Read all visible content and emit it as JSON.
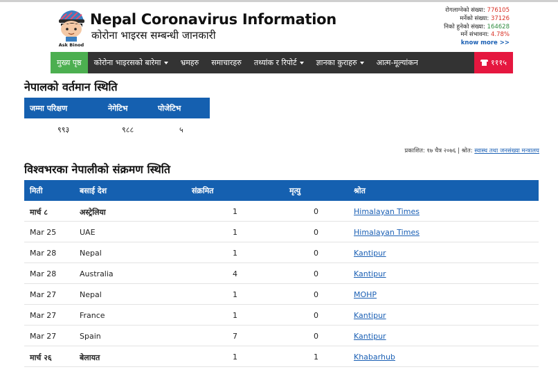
{
  "header": {
    "title": "Nepal Coronavirus Information",
    "subtitle": "कोरोना भाइरस सम्बन्धी जानकारी",
    "logo_text": "Ask Binod",
    "stats": [
      {
        "label": "रोगलाग्नेको संख्या:",
        "value": "776105",
        "color": "#d93025"
      },
      {
        "label": "मर्नेको संख्या:",
        "value": "37126",
        "color": "#d93025"
      },
      {
        "label": "निको हुनेको संख्या:",
        "value": "164628",
        "color": "#2e8b3e"
      },
      {
        "label": "मर्ने संभावना:",
        "value": "4.78%",
        "color": "#d93025"
      }
    ],
    "know_more": "know more >>"
  },
  "nav": {
    "items": [
      {
        "label": "मुख्य पृष्ठ",
        "active": true,
        "dropdown": false
      },
      {
        "label": "कोरोना भाइरसको बारेमा",
        "active": false,
        "dropdown": true
      },
      {
        "label": "भ्रमहरु",
        "active": false,
        "dropdown": false
      },
      {
        "label": "समाचारहरु",
        "active": false,
        "dropdown": false
      },
      {
        "label": "तथ्यांक र रिपोर्ट",
        "active": false,
        "dropdown": true
      },
      {
        "label": "ज्ञानका कुराहरु",
        "active": false,
        "dropdown": true
      },
      {
        "label": "आत्म-मूल्यांकन",
        "active": false,
        "dropdown": false
      }
    ],
    "hotline": "१११५",
    "hotline_icon": "phone-icon"
  },
  "nepal_status": {
    "heading": "नेपालको वर्तमान स्थिति",
    "columns": [
      "जम्मा परिक्षण",
      "नेगेटिभ",
      "पोजेटिभ"
    ],
    "values": [
      "९९३",
      "९८८",
      "५"
    ],
    "source_prefix": "प्रकाशित: १७ चैत्र २०७६ | श्रोत:",
    "source_link": "स्वास्थ तथा जनसंख्या मन्त्रालय"
  },
  "world_status": {
    "heading": "विश्वभरका नेपालीको संक्रमण स्थिति",
    "columns": [
      "मिती",
      "बसाई देश",
      "संक्रमित",
      "मृत्यु",
      "श्रोत"
    ],
    "rows": [
      {
        "date": "मार्च ८",
        "country": "अस्ट्रेलिया",
        "infected": "1",
        "deaths": "0",
        "source": "Himalayan Times",
        "native": true
      },
      {
        "date": "Mar 25",
        "country": "UAE",
        "infected": "1",
        "deaths": "0",
        "source": "Himalayan Times",
        "native": false
      },
      {
        "date": "Mar 28",
        "country": "Nepal",
        "infected": "1",
        "deaths": "0",
        "source": "Kantipur",
        "native": false
      },
      {
        "date": "Mar 28",
        "country": "Australia",
        "infected": "4",
        "deaths": "0",
        "source": "Kantipur",
        "native": false
      },
      {
        "date": "Mar 27",
        "country": "Nepal",
        "infected": "1",
        "deaths": "0",
        "source": "MOHP",
        "native": false
      },
      {
        "date": "Mar 27",
        "country": "France",
        "infected": "1",
        "deaths": "0",
        "source": "Kantipur",
        "native": false
      },
      {
        "date": "Mar 27",
        "country": "Spain",
        "infected": "7",
        "deaths": "0",
        "source": "Kantipur",
        "native": false
      },
      {
        "date": "मार्च २६",
        "country": "बेलायत",
        "infected": "1",
        "deaths": "1",
        "source": "Khabarhub",
        "native": true
      }
    ]
  },
  "colors": {
    "nav_bg": "#333333",
    "nav_active": "#4caf50",
    "hotline_bg": "#e5173f",
    "table_header": "#1560b0",
    "link": "#1a5fb4"
  }
}
